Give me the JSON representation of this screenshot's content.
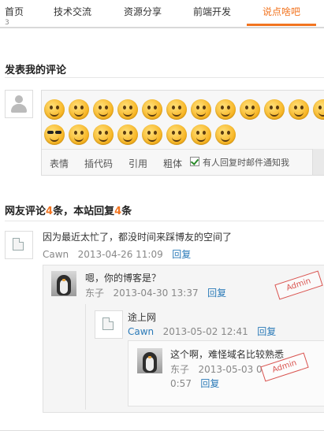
{
  "nav": {
    "items": [
      "首页",
      "技术交流",
      "资源分享",
      "前端开发",
      "说点啥吧"
    ],
    "active_index": 4,
    "overflow_char": "3"
  },
  "form": {
    "title": "发表我的评论",
    "toolbar": {
      "emoji_label": "表情",
      "code_label": "插代码",
      "quote_label": "引用",
      "bold_label": "粗体",
      "notify_label": "有人回复时邮件通知我",
      "notify_checked": true
    },
    "emoji_icons": [
      "grin-emoji-icon",
      "smirk-emoji-icon",
      "frown-emoji-icon",
      "smile-emoji-icon",
      "laugh-emoji-icon",
      "tongue-emoji-icon",
      "angry-emoji-icon",
      "think-emoji-icon",
      "surprise-emoji-icon",
      "sleep-emoji-icon",
      "happy-emoji-icon",
      "teeth-emoji-icon",
      "cool-emoji-icon",
      "sweat-emoji-icon",
      "cry-emoji-icon",
      "scream-emoji-icon",
      "question-emoji-icon",
      "kiss-emoji-icon",
      "shock-emoji-icon",
      "sad-emoji-icon"
    ]
  },
  "comments_section": {
    "title_prefix": "网友评论",
    "comment_count": "4",
    "title_middle": "条，本站回复",
    "reply_count": "4",
    "title_suffix": "条"
  },
  "comments": [
    {
      "text": "因为最近太忙了，都没时间来踩博友的空间了",
      "author": "Cawn",
      "date": "2013-04-26 11:09",
      "reply_label": "回复"
    },
    {
      "text": "嗯，你的博客是？",
      "author": "东子",
      "date": "2013-04-30 13:37",
      "reply_label": "回复",
      "stamp": "Admin"
    },
    {
      "text": "途上网",
      "author": "Cawn",
      "date": "2013-05-02 12:41",
      "reply_label": "回复"
    },
    {
      "text": "这个啊，难怪域名比较熟悉",
      "author": "东子",
      "date_line1": "2013-05-03 0",
      "date_line2": "0:57",
      "reply_label": "回复",
      "stamp": "Admin"
    }
  ],
  "colors": {
    "accent": "#f27420",
    "link": "#2a7ab8",
    "stamp": "#d9534f"
  }
}
